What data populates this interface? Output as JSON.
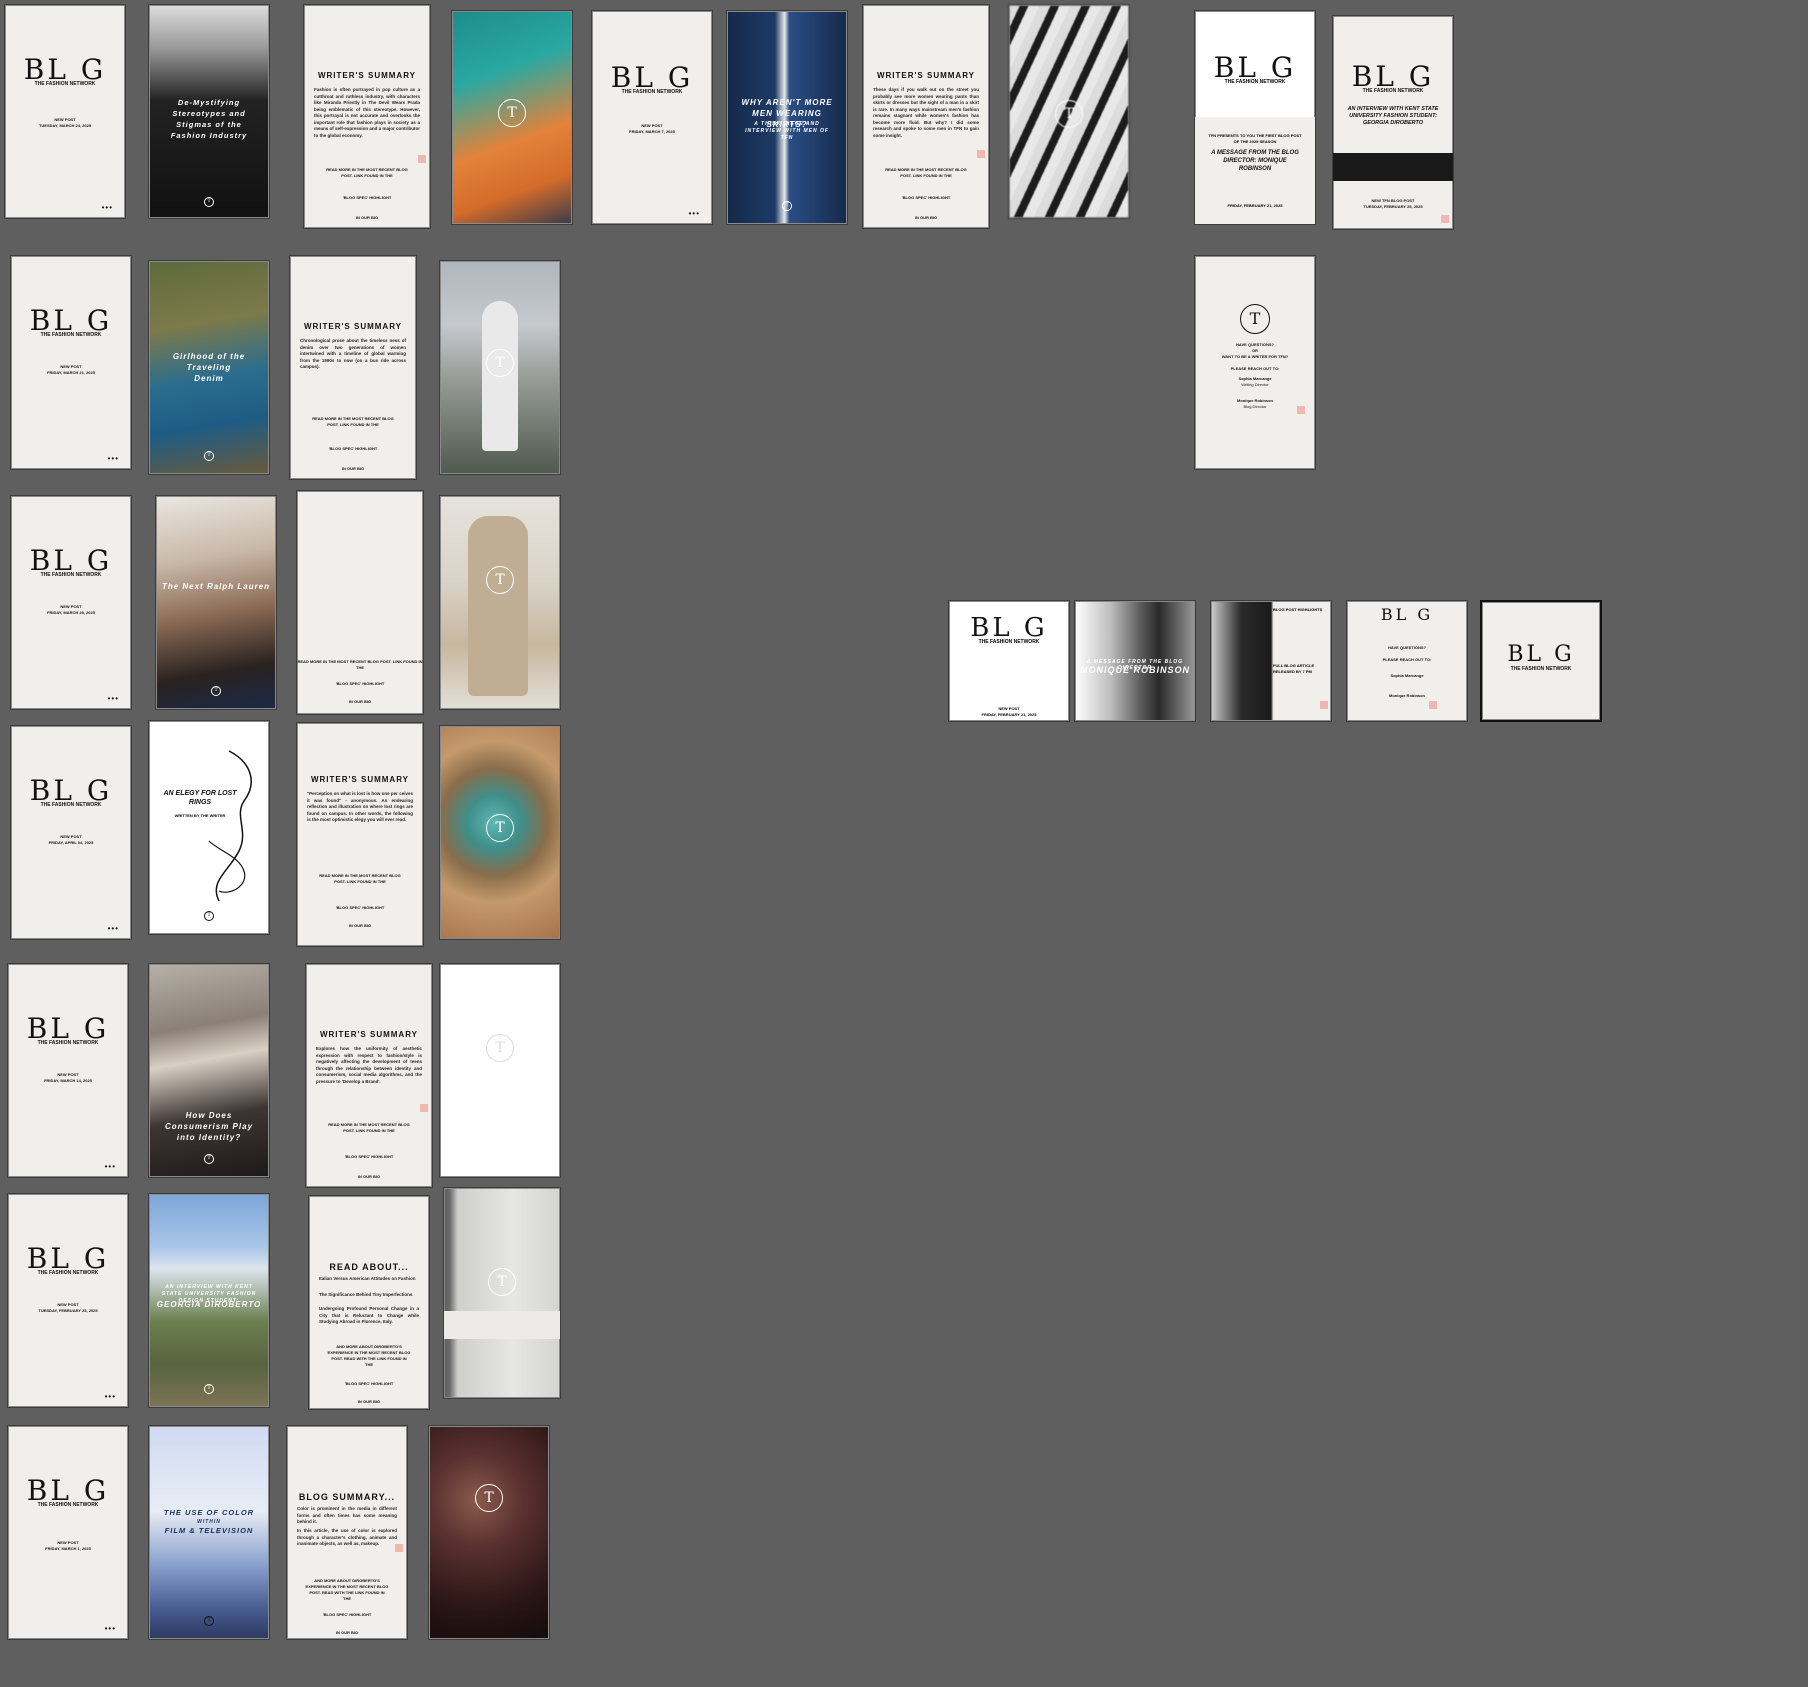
{
  "blog": {
    "logo": "BL G",
    "network": "THE FASHION NETWORK",
    "new_post": "NEW POST",
    "more": "•••",
    "dates": {
      "mar24": "TUESDAY, MARCH 24, 2025",
      "mar7": "FRIDAY, MARCH 7, 2025",
      "mar21": "FRIDAY, MARCH 21, 2025",
      "mar28": "FRIDAY, MARCH 28, 2025",
      "apr4": "FRIDAY, APRIL 04, 2025",
      "mar14": "FRIDAY, MARCH 14, 2025",
      "feb25": "TUESDAY, FEBRUARY 25, 2025",
      "mar1": "FRIDAY, MARCH 1, 2025",
      "feb21": "FRIDAY, FEBRUARY 21, 2025",
      "feb28": "FRIDAY, FEBRUARY 28, 2025",
      "feb25b": "TUESDAY, FEBRUARY 25, 2025"
    }
  },
  "titles": {
    "stereotypes": "De-Mystifying Stereotypes and Stigmas of the Fashion Industry",
    "skirts": "WHY AREN'T MORE MEN WEARING SKIRTS?",
    "skirts_sub": "A THINK PIECE AND INTERVIEW WITH MEN OF TFN",
    "denim": "Girlhood of the Traveling Denim",
    "ralph": "The Next Ralph Lauren",
    "rings": "AN ELEGY FOR LOST RINGS",
    "rings_sub": "WRITTEN BY THE WRITER",
    "consumerism": "How Does Consumerism Play into Identity?",
    "interview": "AN INTERVIEW WITH KENT STATE UNIVERSITY FASHION DESIGN STUDENT:",
    "interview_name": "GEORGIA DIROBERTO",
    "color": "THE USE OF COLOR",
    "color_within": "WITHIN",
    "color_film": "FILM & TELEVISION",
    "message": "A MESSAGE FROM THE BLOG DIRECTOR: MONIQUE ROBINSON",
    "message_pre": "TFN PRESENTS TO YOU THE FIRST BLOG POST OF THE 2025 SEASON",
    "interview2": "AN INTERVIEW WITH KENT STATE UNIVERSITY FASHION STUDENT: GEORGIA DIROBERTO",
    "new_tfn": "NEW TFN BLOG POST",
    "director_photo": "MONIQUE ROBINSON",
    "director_pre": "A MESSAGE FROM THE BLOG DIRECTOR"
  },
  "summary": {
    "writers": "WRITER'S SUMMARY",
    "read_about": "READ ABOUT...",
    "blog_summary": "BLOG SUMMARY...",
    "p1": "Fashion is often portrayed in pop culture as a cutthroat and ruthless industry, with characters like Miranda Priestly in The Devil Wears Prada being emblematic of this stereotype. However, this portrayal is not accurate and overlooks the important role that fashion plays in society as a means of self-expression and a major contributor to the global economy.",
    "p2": "These days if you walk out on the street you probably see more women wearing pants than skirts or dresses but the sight of a man in a skirt is rare. In many ways mainstream men's fashion remains stagnant while women's fashion has become more fluid. But why? I did some research and spoke to some men in TFN to gain some insight.",
    "p3": "Chronological prose about the timeless ness of denim over two generations of women intertwined with a timeline of global warming from the 1990s to now (on a bus ride across campus).",
    "p4": "\"Perception on what is lost is how one per ceives it was found\" - anonymous. An endearing reflection and illustration on where lost rings are found on campus. In other words, the following is the most optimistic elegy you will ever read.",
    "p5": "Explores how the uniformity of aesthetic expression with respect to fashion/style is negatively affecting the development of teens through the relationship between identity and consumerism, social media algorithms, and the pressure to 'Develop a Brand'.",
    "read_more": "READ MORE IN THE MOST RECENT BLOG POST. LINK FOUND IN THE",
    "highlight": "'BLOG SPEC' HIGHLIGHT",
    "in_bio": "IN OUR BIO",
    "bullets1": [
      "Italian Versus American Attitudes on Fashion",
      "The Significance Behind Tiny Imperfections",
      "Undergoing Profound Personal Change in a City that is Reluctant to Change while Studying Abroad in Florence, Italy."
    ],
    "bullets2": [
      "Color is prominent in the media in different forms and often times has some meaning behind it.",
      "In this article, the use of color is explored through a character's clothing, animate and inanimate objects, as well as, makeup."
    ],
    "and_more": "AND MORE ABOUT DIROBERTO'S EXPERIENCE IN THE MOST RECENT BLOG POST. READ WITH THE LINK FOUND IN THE"
  },
  "contact": {
    "q1": "HAVE QUESTIONS?",
    "or": "OR",
    "q2": "WANT TO BE A WRITER FOR TFN?",
    "reach": "PLEASE REACH OUT TO:",
    "name1": "Sophia Marcange",
    "role1": "Writing Director",
    "name2": "Monique Robinson",
    "role2": "Blog Director"
  },
  "highlights": {
    "title": "BLOG POST HIGHLIGHTS",
    "full": "FULL BLOG ARTICLE RELEASED BY 7 PM"
  },
  "colors": {
    "canvas": "#5f5f5f",
    "paper": "#f0efeb",
    "accent_pink": "#f2b6b0"
  }
}
